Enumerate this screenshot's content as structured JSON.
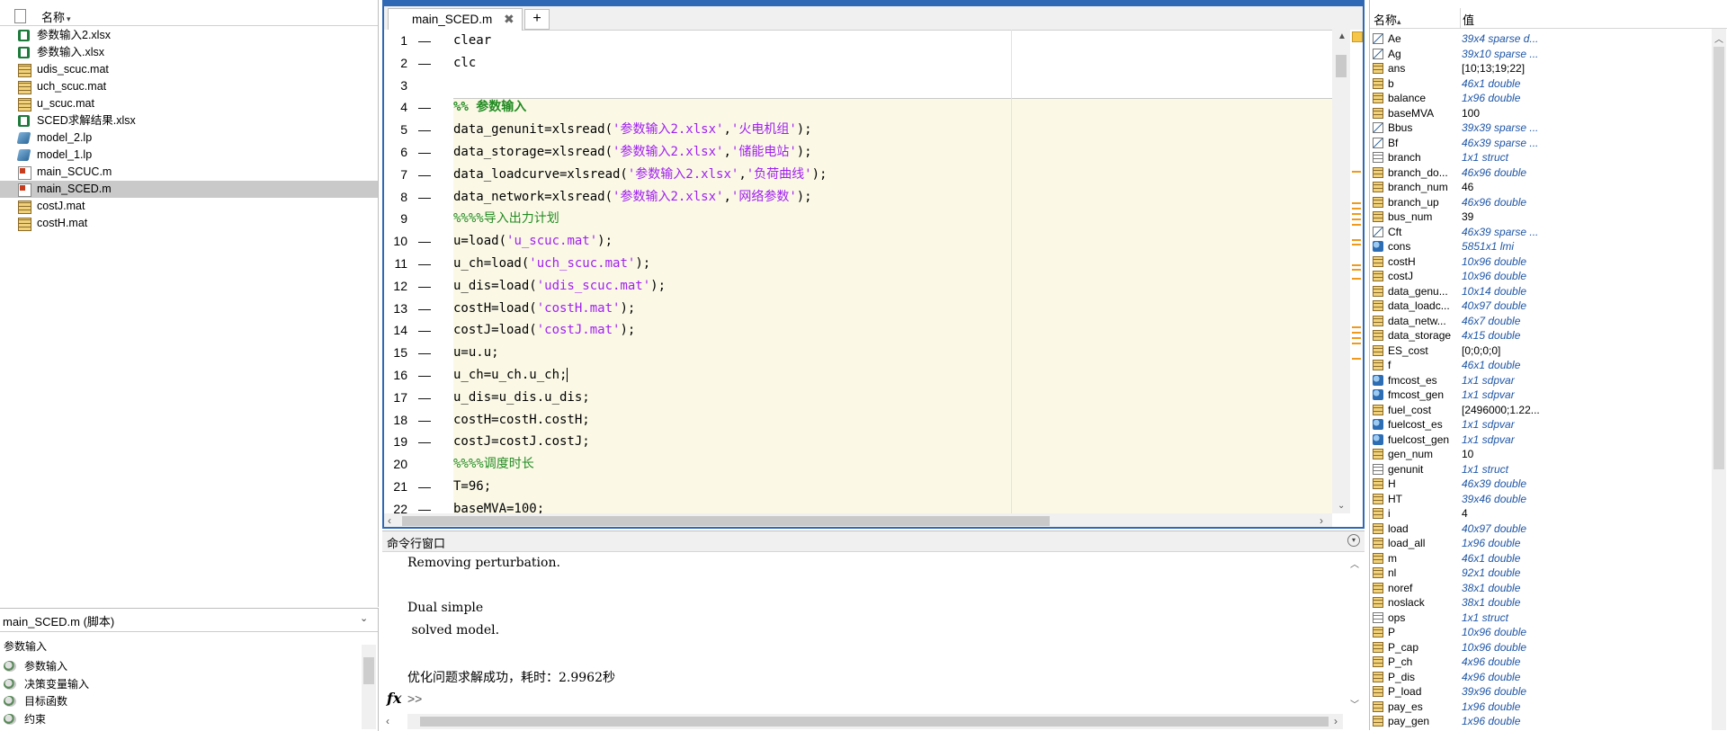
{
  "file_browser": {
    "header": {
      "name_label": "名称",
      "sort_indicator": "▾"
    },
    "files": [
      {
        "name": "参数输入2.xlsx",
        "type": "xlsx",
        "selected": false
      },
      {
        "name": "参数输入.xlsx",
        "type": "xlsx",
        "selected": false
      },
      {
        "name": "udis_scuc.mat",
        "type": "mat",
        "selected": false
      },
      {
        "name": "uch_scuc.mat",
        "type": "mat",
        "selected": false
      },
      {
        "name": "u_scuc.mat",
        "type": "mat",
        "selected": false
      },
      {
        "name": "SCED求解结果.xlsx",
        "type": "xlsx",
        "selected": false
      },
      {
        "name": "model_2.lp",
        "type": "lp",
        "selected": false
      },
      {
        "name": "model_1.lp",
        "type": "lp",
        "selected": false
      },
      {
        "name": "main_SCUC.m",
        "type": "m",
        "selected": false
      },
      {
        "name": "main_SCED.m",
        "type": "m",
        "selected": true
      },
      {
        "name": "costJ.mat",
        "type": "mat",
        "selected": false
      },
      {
        "name": "costH.mat",
        "type": "mat",
        "selected": false
      }
    ]
  },
  "details": {
    "title": "main_SCED.m  (脚本)",
    "subtitle": "参数输入",
    "sections": [
      "参数输入",
      "决策变量输入",
      "目标函数",
      "约束"
    ]
  },
  "editor": {
    "tab_label": "main_SCED.m",
    "close_glyph": "✖",
    "add_glyph": "+",
    "lines": [
      {
        "num": "1",
        "bp": "—",
        "segments": [
          {
            "t": "clear",
            "c": ""
          }
        ]
      },
      {
        "num": "2",
        "bp": "—",
        "segments": [
          {
            "t": "clc",
            "c": ""
          }
        ]
      },
      {
        "num": "3",
        "bp": "",
        "segments": []
      },
      {
        "num": "4",
        "bp": "—",
        "segments": [
          {
            "t": "%% 参数输入",
            "c": "cell-title"
          }
        ]
      },
      {
        "num": "5",
        "bp": "—",
        "segments": [
          {
            "t": "data_genunit=xlsread(",
            "c": ""
          },
          {
            "t": "'参数输入2.xlsx'",
            "c": "str"
          },
          {
            "t": ",",
            "c": ""
          },
          {
            "t": "'火电机组'",
            "c": "str"
          },
          {
            "t": ");",
            "c": ""
          }
        ]
      },
      {
        "num": "6",
        "bp": "—",
        "segments": [
          {
            "t": "data_storage=xlsread(",
            "c": ""
          },
          {
            "t": "'参数输入2.xlsx'",
            "c": "str"
          },
          {
            "t": ",",
            "c": ""
          },
          {
            "t": "'储能电站'",
            "c": "str"
          },
          {
            "t": ");",
            "c": ""
          }
        ]
      },
      {
        "num": "7",
        "bp": "—",
        "segments": [
          {
            "t": "data_loadcurve=xlsread(",
            "c": ""
          },
          {
            "t": "'参数输入2.xlsx'",
            "c": "str"
          },
          {
            "t": ",",
            "c": ""
          },
          {
            "t": "'负荷曲线'",
            "c": "str"
          },
          {
            "t": ");",
            "c": ""
          }
        ]
      },
      {
        "num": "8",
        "bp": "—",
        "segments": [
          {
            "t": "data_network=xlsread(",
            "c": ""
          },
          {
            "t": "'参数输入2.xlsx'",
            "c": "str"
          },
          {
            "t": ",",
            "c": ""
          },
          {
            "t": "'网络参数'",
            "c": "str"
          },
          {
            "t": ");",
            "c": ""
          }
        ]
      },
      {
        "num": "9",
        "bp": "",
        "segments": [
          {
            "t": "%%%%导入出力计划",
            "c": "cm"
          }
        ]
      },
      {
        "num": "10",
        "bp": "—",
        "segments": [
          {
            "t": "u=load(",
            "c": ""
          },
          {
            "t": "'u_scuc.mat'",
            "c": "str"
          },
          {
            "t": ");",
            "c": ""
          }
        ]
      },
      {
        "num": "11",
        "bp": "—",
        "segments": [
          {
            "t": "u_ch=load(",
            "c": ""
          },
          {
            "t": "'uch_scuc.mat'",
            "c": "str"
          },
          {
            "t": ");",
            "c": ""
          }
        ]
      },
      {
        "num": "12",
        "bp": "—",
        "segments": [
          {
            "t": "u_dis=load(",
            "c": ""
          },
          {
            "t": "'udis_scuc.mat'",
            "c": "str"
          },
          {
            "t": ");",
            "c": ""
          }
        ]
      },
      {
        "num": "13",
        "bp": "—",
        "segments": [
          {
            "t": "costH=load(",
            "c": ""
          },
          {
            "t": "'costH.mat'",
            "c": "str"
          },
          {
            "t": ");",
            "c": ""
          }
        ]
      },
      {
        "num": "14",
        "bp": "—",
        "segments": [
          {
            "t": "costJ=load(",
            "c": ""
          },
          {
            "t": "'costJ.mat'",
            "c": "str"
          },
          {
            "t": ");",
            "c": ""
          }
        ]
      },
      {
        "num": "15",
        "bp": "—",
        "segments": [
          {
            "t": "u=u.u;",
            "c": ""
          }
        ]
      },
      {
        "num": "16",
        "bp": "—",
        "segments": [
          {
            "t": "u_ch=u_ch.u_ch;",
            "c": ""
          }
        ],
        "cursor": true
      },
      {
        "num": "17",
        "bp": "—",
        "segments": [
          {
            "t": "u_dis=u_dis.u_dis;",
            "c": ""
          }
        ]
      },
      {
        "num": "18",
        "bp": "—",
        "segments": [
          {
            "t": "costH=costH.costH;",
            "c": ""
          }
        ]
      },
      {
        "num": "19",
        "bp": "—",
        "segments": [
          {
            "t": "costJ=costJ.costJ;",
            "c": ""
          }
        ]
      },
      {
        "num": "20",
        "bp": "",
        "segments": [
          {
            "t": "%%%%调度时长",
            "c": "cm"
          }
        ]
      },
      {
        "num": "21",
        "bp": "—",
        "segments": [
          {
            "t": "T=96;",
            "c": ""
          }
        ]
      },
      {
        "num": "22",
        "bp": "—",
        "segments": [
          {
            "t": "baseMVA=100;",
            "c": ""
          }
        ]
      }
    ]
  },
  "command_window": {
    "title": "命令行窗口",
    "lines": [
      {
        "text": "Removing perturbation."
      },
      {
        "text": ""
      },
      {
        "text": "Dual simple"
      },
      {
        "text": " solved model."
      },
      {
        "text": ""
      },
      {
        "text": "优化问题求解成功，耗时：2.9962秒"
      }
    ],
    "fx": "fx",
    "prompt": ">>"
  },
  "workspace": {
    "header": {
      "name_label": "名称",
      "sort_indicator": "▴",
      "value_label": "值"
    },
    "variables": [
      {
        "name": "Ae",
        "value": "39x4 sparse d...",
        "icon": "sparse",
        "italic": true
      },
      {
        "name": "Ag",
        "value": "39x10 sparse ...",
        "icon": "sparse",
        "italic": true
      },
      {
        "name": "ans",
        "value": "[10;13;19;22]",
        "icon": "grid",
        "italic": false
      },
      {
        "name": "b",
        "value": "46x1 double",
        "icon": "grid",
        "italic": true
      },
      {
        "name": "balance",
        "value": "1x96 double",
        "icon": "grid",
        "italic": true
      },
      {
        "name": "baseMVA",
        "value": "100",
        "icon": "grid",
        "italic": false
      },
      {
        "name": "Bbus",
        "value": "39x39 sparse ...",
        "icon": "sparse",
        "italic": true
      },
      {
        "name": "Bf",
        "value": "46x39 sparse ...",
        "icon": "sparse",
        "italic": true
      },
      {
        "name": "branch",
        "value": "1x1 struct",
        "icon": "struct",
        "italic": true
      },
      {
        "name": "branch_do...",
        "value": "46x96 double",
        "icon": "grid",
        "italic": true
      },
      {
        "name": "branch_num",
        "value": "46",
        "icon": "grid",
        "italic": false
      },
      {
        "name": "branch_up",
        "value": "46x96 double",
        "icon": "grid",
        "italic": true
      },
      {
        "name": "bus_num",
        "value": "39",
        "icon": "grid",
        "italic": false
      },
      {
        "name": "Cft",
        "value": "46x39 sparse ...",
        "icon": "sparse",
        "italic": true
      },
      {
        "name": "cons",
        "value": "5851x1 lmi",
        "icon": "obj",
        "italic": true
      },
      {
        "name": "costH",
        "value": "10x96 double",
        "icon": "grid",
        "italic": true
      },
      {
        "name": "costJ",
        "value": "10x96 double",
        "icon": "grid",
        "italic": true
      },
      {
        "name": "data_genu...",
        "value": "10x14 double",
        "icon": "grid",
        "italic": true
      },
      {
        "name": "data_loadc...",
        "value": "40x97 double",
        "icon": "grid",
        "italic": true
      },
      {
        "name": "data_netw...",
        "value": "46x7 double",
        "icon": "grid",
        "italic": true
      },
      {
        "name": "data_storage",
        "value": "4x15 double",
        "icon": "grid",
        "italic": true
      },
      {
        "name": "ES_cost",
        "value": "[0;0;0;0]",
        "icon": "grid",
        "italic": false
      },
      {
        "name": "f",
        "value": "46x1 double",
        "icon": "grid",
        "italic": true
      },
      {
        "name": "fmcost_es",
        "value": "1x1 sdpvar",
        "icon": "obj",
        "italic": true
      },
      {
        "name": "fmcost_gen",
        "value": "1x1 sdpvar",
        "icon": "obj",
        "italic": true
      },
      {
        "name": "fuel_cost",
        "value": "[2496000;1.22...",
        "icon": "grid",
        "italic": false
      },
      {
        "name": "fuelcost_es",
        "value": "1x1 sdpvar",
        "icon": "obj",
        "italic": true
      },
      {
        "name": "fuelcost_gen",
        "value": "1x1 sdpvar",
        "icon": "obj",
        "italic": true
      },
      {
        "name": "gen_num",
        "value": "10",
        "icon": "grid",
        "italic": false
      },
      {
        "name": "genunit",
        "value": "1x1 struct",
        "icon": "struct",
        "italic": true
      },
      {
        "name": "H",
        "value": "46x39 double",
        "icon": "grid",
        "italic": true
      },
      {
        "name": "HT",
        "value": "39x46 double",
        "icon": "grid",
        "italic": true
      },
      {
        "name": "i",
        "value": "4",
        "icon": "grid",
        "italic": false
      },
      {
        "name": "load",
        "value": "40x97 double",
        "icon": "grid",
        "italic": true
      },
      {
        "name": "load_all",
        "value": "1x96 double",
        "icon": "grid",
        "italic": true
      },
      {
        "name": "m",
        "value": "46x1 double",
        "icon": "grid",
        "italic": true
      },
      {
        "name": "nl",
        "value": "92x1 double",
        "icon": "grid",
        "italic": true
      },
      {
        "name": "noref",
        "value": "38x1 double",
        "icon": "grid",
        "italic": true
      },
      {
        "name": "noslack",
        "value": "38x1 double",
        "icon": "grid",
        "italic": true
      },
      {
        "name": "ops",
        "value": "1x1 struct",
        "icon": "struct",
        "italic": true
      },
      {
        "name": "P",
        "value": "10x96 double",
        "icon": "grid",
        "italic": true
      },
      {
        "name": "P_cap",
        "value": "10x96 double",
        "icon": "grid",
        "italic": true
      },
      {
        "name": "P_ch",
        "value": "4x96 double",
        "icon": "grid",
        "italic": true
      },
      {
        "name": "P_dis",
        "value": "4x96 double",
        "icon": "grid",
        "italic": true
      },
      {
        "name": "P_load",
        "value": "39x96 double",
        "icon": "grid",
        "italic": true
      },
      {
        "name": "pay_es",
        "value": "1x96 double",
        "icon": "grid",
        "italic": true
      },
      {
        "name": "pay_gen",
        "value": "1x96 double",
        "icon": "grid",
        "italic": true
      }
    ]
  }
}
